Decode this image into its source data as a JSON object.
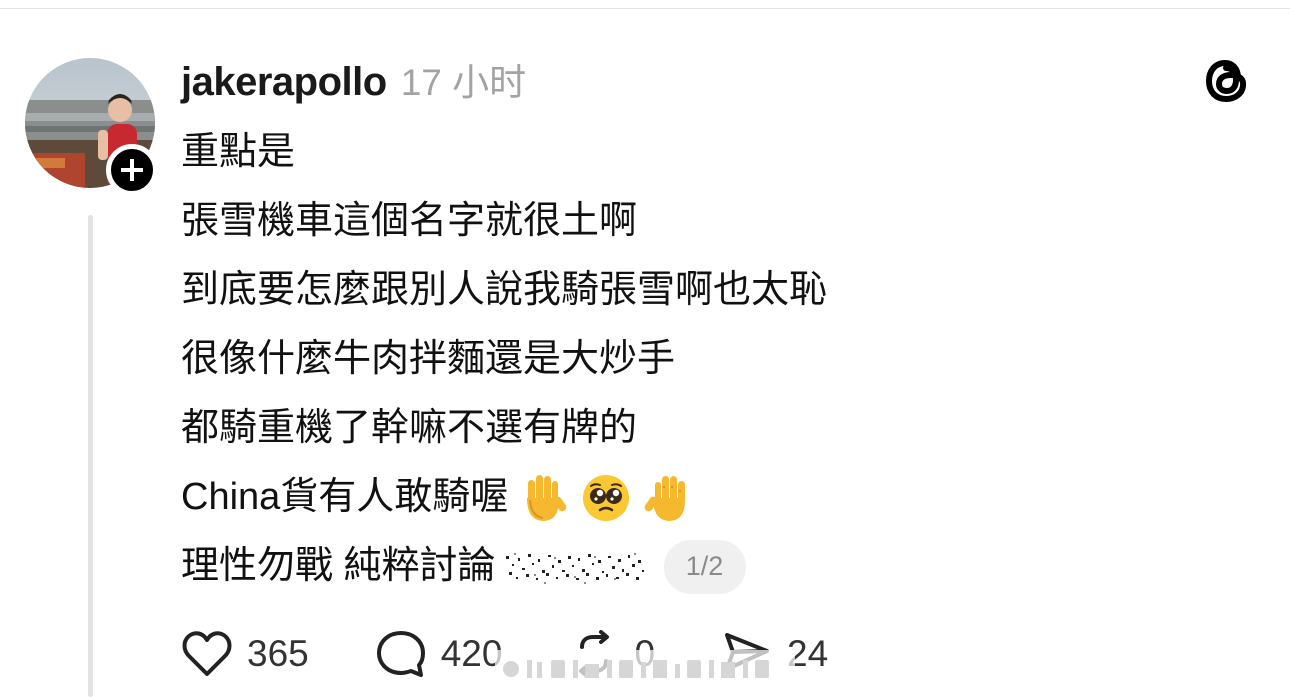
{
  "post": {
    "username": "jakerapollo",
    "timestamp": "17 小时",
    "lines": [
      "重點是",
      "張雪機車這個名字就很土啊",
      "到底要怎麼跟別人說我騎張雪啊也太恥",
      "很像什麼牛肉拌麵還是大炒手",
      "都騎重機了幹嘛不選有牌的",
      "China貨有人敢騎喔",
      "理性勿戰 純粹討論"
    ],
    "emojis": [
      "raised-hand-icon",
      "pleading-face-icon",
      "raised-back-of-hand-icon"
    ],
    "page_indicator": "1/2"
  },
  "actions": {
    "likes": "365",
    "comments": "420",
    "reposts": "0",
    "shares": "24"
  },
  "icons": {
    "avatar": "avatar",
    "follow": "plus-icon",
    "app_logo": "threads-logo-icon",
    "like": "heart-icon",
    "comment": "comment-icon",
    "repost": "repost-icon",
    "share": "share-icon"
  },
  "colors": {
    "text": "#111111",
    "muted": "#a3a3a3",
    "thread_line": "#e3e3e3",
    "badge": "#000000",
    "pill_bg": "#f0f0f0"
  }
}
